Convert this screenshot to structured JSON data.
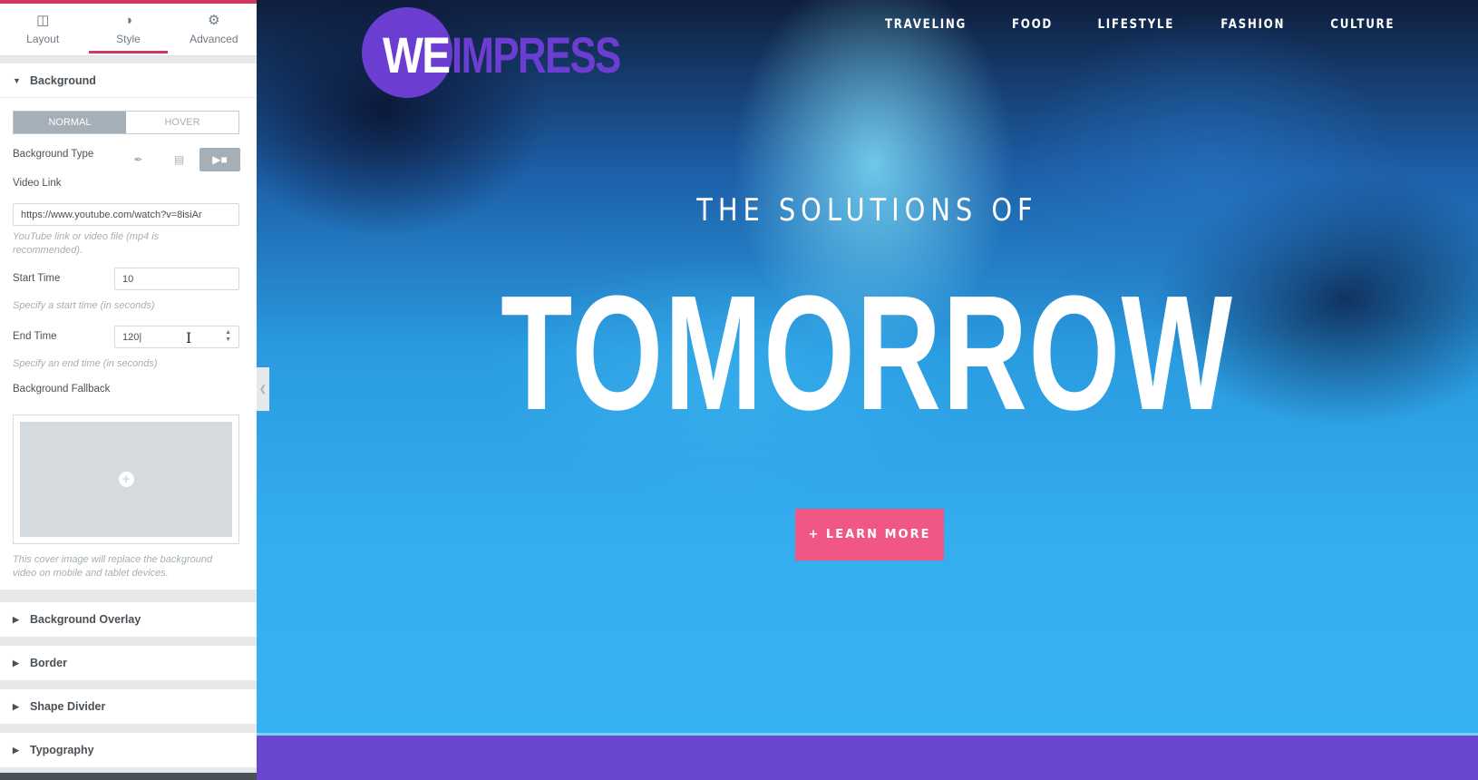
{
  "panel": {
    "tabs": [
      {
        "label": "Layout",
        "icon": "layout-icon"
      },
      {
        "label": "Style",
        "icon": "style-icon"
      },
      {
        "label": "Advanced",
        "icon": "gear-icon"
      }
    ],
    "background_section": {
      "title": "Background",
      "state_toggle": {
        "normal": "NORMAL",
        "hover": "HOVER",
        "selected": "NORMAL"
      },
      "background_type_label": "Background Type",
      "background_type_selected": "video",
      "video_link_label": "Video Link",
      "video_link_value": "https://www.youtube.com/watch?v=8isiAr",
      "video_link_note": "YouTube link or video file (mp4 is recommended).",
      "start_time_label": "Start Time",
      "start_time_value": "10",
      "start_time_note": "Specify a start time (in seconds)",
      "end_time_label": "End Time",
      "end_time_value": "120|",
      "end_time_note": "Specify an end time (in seconds)",
      "fallback_label": "Background Fallback",
      "fallback_note": "This cover image will replace the background video on mobile and tablet devices."
    },
    "collapsed_sections": [
      "Background Overlay",
      "Border",
      "Shape Divider",
      "Typography"
    ]
  },
  "preview": {
    "logo": {
      "part1": "WE",
      "part2": "IMPRESS"
    },
    "nav": [
      "TRAVELING",
      "FOOD",
      "LIFESTYLE",
      "FASHION",
      "CULTURE"
    ],
    "subtitle": "THE SOLUTIONS OF",
    "headline": "TOMORROW",
    "cta": "+ LEARN MORE"
  },
  "colors": {
    "accent_pink": "#d1375e",
    "brand_purple": "#6c3dd1",
    "cta_pink": "#f05784",
    "footer_purple": "#6b47cf"
  }
}
